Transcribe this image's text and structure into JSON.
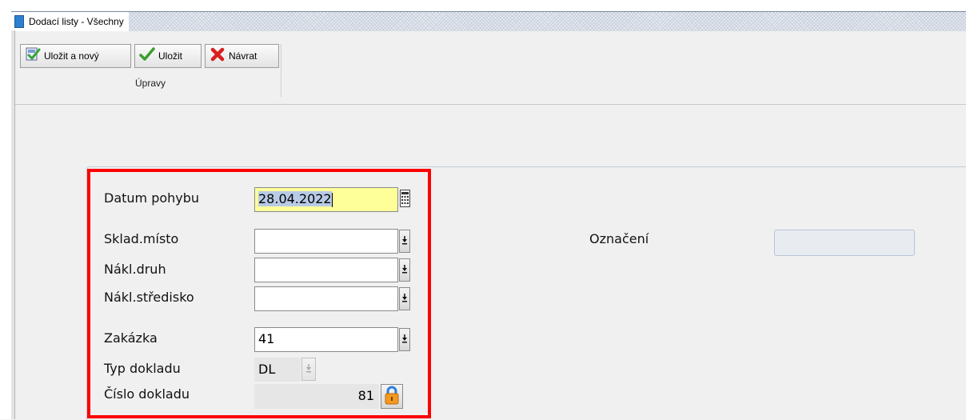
{
  "window": {
    "title": "Dodací listy - Všechny"
  },
  "toolbar": {
    "save_new_label": "Uložit a nový",
    "save_label": "Uložit",
    "back_label": "Návrat",
    "group_label": "Úpravy"
  },
  "form": {
    "datum_pohybu": {
      "label": "Datum pohybu",
      "value": "28.04.2022"
    },
    "sklad_misto": {
      "label": "Sklad.místo",
      "value": ""
    },
    "nakl_druh": {
      "label": "Nákl.druh",
      "value": ""
    },
    "nakl_stredisko": {
      "label": "Nákl.středisko",
      "value": ""
    },
    "zakazka": {
      "label": "Zakázka",
      "value": "41"
    },
    "typ_dokladu": {
      "label": "Typ dokladu",
      "value": "DL"
    },
    "cislo_dokladu": {
      "label": "Číslo dokladu",
      "value": "81"
    },
    "oznaceni": {
      "label": "Označení",
      "value": ""
    }
  },
  "colors": {
    "highlight": "#ff0000",
    "date_field_bg": "#ffff99",
    "title_icon": "#2f7fd0"
  },
  "icons": {
    "save_new": "save-new-icon",
    "save": "checkmark-icon",
    "back": "red-x-icon",
    "calendar": "calendar-icon",
    "dropdown": "dropdown-arrow-icon",
    "lock": "lock-icon"
  }
}
